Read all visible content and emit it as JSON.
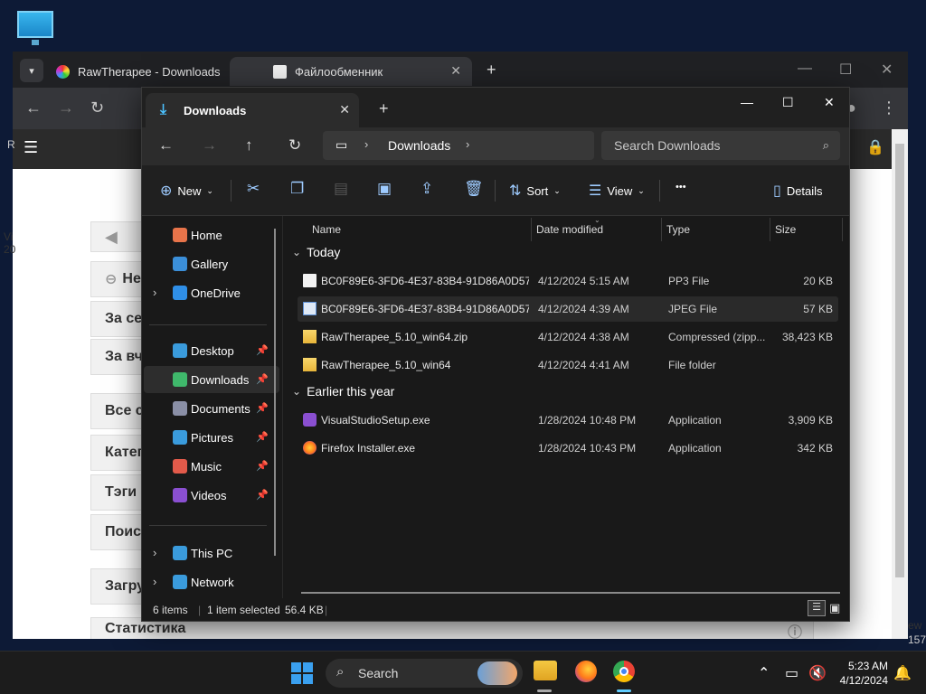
{
  "chrome": {
    "tabs": [
      {
        "label": "RawTherapee - Downloads"
      },
      {
        "label": "Файлообменник"
      }
    ]
  },
  "webpage": {
    "cards": [
      "Не",
      "За се",
      "За вч",
      "Все с",
      "Катег",
      "Тэги",
      "Поис",
      "Загру",
      "Статистика"
    ],
    "edge_left": [
      "R",
      "Vi",
      "20"
    ],
    "edge_right": [
      "ew",
      "157"
    ]
  },
  "explorer": {
    "tab_label": "Downloads",
    "address": {
      "folder": "Downloads"
    },
    "search": {
      "placeholder": "Search Downloads"
    },
    "commands": {
      "new": "New",
      "sort": "Sort",
      "view": "View",
      "more": "•••",
      "details": "Details"
    },
    "sidebar": [
      {
        "label": "Home",
        "icon": "home-icon",
        "color": "#e8744a"
      },
      {
        "label": "Gallery",
        "icon": "gallery-icon",
        "color": "#3b8fd9"
      },
      {
        "label": "OneDrive",
        "icon": "onedrive-icon",
        "color": "#2f8fe8",
        "expandable": true
      },
      {
        "label": "Desktop",
        "icon": "desktop-icon",
        "color": "#3a9bdc",
        "pinned": true
      },
      {
        "label": "Downloads",
        "icon": "downloads-icon",
        "color": "#3fb86b",
        "pinned": true,
        "selected": true
      },
      {
        "label": "Documents",
        "icon": "documents-icon",
        "color": "#8a8fa6",
        "pinned": true
      },
      {
        "label": "Pictures",
        "icon": "pictures-icon",
        "color": "#3a9bdc",
        "pinned": true
      },
      {
        "label": "Music",
        "icon": "music-icon",
        "color": "#e25a4a",
        "pinned": true
      },
      {
        "label": "Videos",
        "icon": "videos-icon",
        "color": "#8a4fd1",
        "pinned": true
      },
      {
        "label": "This PC",
        "icon": "this-pc-icon",
        "color": "#3a9bdc",
        "expandable": true
      },
      {
        "label": "Network",
        "icon": "network-icon",
        "color": "#3a9bdc",
        "expandable": true
      }
    ],
    "columns": {
      "name": "Name",
      "date": "Date modified",
      "type": "Type",
      "size": "Size"
    },
    "groups": [
      {
        "label": "Today",
        "files": [
          {
            "name": "BC0F89E6-3FD6-4E37-83B4-91D86A0D57...",
            "date": "4/12/2024 5:15 AM",
            "type": "PP3 File",
            "size": "20 KB",
            "icon": "file-icon"
          },
          {
            "name": "BC0F89E6-3FD6-4E37-83B4-91D86A0D57...",
            "date": "4/12/2024 4:39 AM",
            "type": "JPEG File",
            "size": "57 KB",
            "icon": "image-file-icon",
            "selected": true
          },
          {
            "name": "RawTherapee_5.10_win64.zip",
            "date": "4/12/2024 4:38 AM",
            "type": "Compressed (zipp...",
            "size": "38,423 KB",
            "icon": "zip-folder-icon"
          },
          {
            "name": "RawTherapee_5.10_win64",
            "date": "4/12/2024 4:41 AM",
            "type": "File folder",
            "size": "",
            "icon": "folder-icon"
          }
        ]
      },
      {
        "label": "Earlier this year",
        "files": [
          {
            "name": "VisualStudioSetup.exe",
            "date": "1/28/2024 10:48 PM",
            "type": "Application",
            "size": "3,909 KB",
            "icon": "visual-studio-icon"
          },
          {
            "name": "Firefox Installer.exe",
            "date": "1/28/2024 10:43 PM",
            "type": "Application",
            "size": "342 KB",
            "icon": "firefox-icon"
          }
        ]
      }
    ],
    "status": {
      "count": "6 items",
      "selection": "1 item selected",
      "size": "56.4 KB"
    }
  },
  "taskbar": {
    "search_label": "Search",
    "time": "5:23 AM",
    "date": "4/12/2024"
  }
}
